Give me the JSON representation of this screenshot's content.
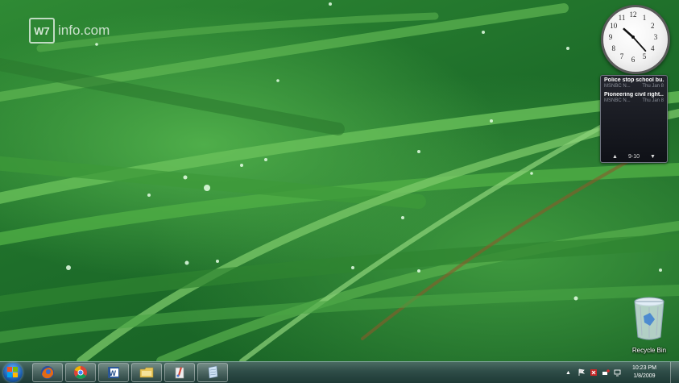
{
  "watermark": {
    "logo": "W7",
    "text": "info.com"
  },
  "clock_gadget": {
    "numerals": [
      "12",
      "1",
      "2",
      "3",
      "4",
      "5",
      "6",
      "7",
      "8",
      "9",
      "10",
      "11"
    ],
    "time_hour": 10,
    "time_minute": 23
  },
  "news_gadget": {
    "items": [
      {
        "headline": "Police stop school bu...",
        "source": "MSNBC N...",
        "date": "Thu Jan 8"
      },
      {
        "headline": "Pioneering civil right...",
        "source": "MSNBC N...",
        "date": "Thu Jan 8"
      }
    ],
    "pager": {
      "prev": "▲",
      "range": "9-10",
      "next": "▼"
    }
  },
  "desktop_icons": [
    {
      "label": "Recycle Bin",
      "icon": "recycle-bin-icon"
    }
  ],
  "taskbar": {
    "pinned": [
      {
        "name": "firefox",
        "icon": "firefox-icon"
      },
      {
        "name": "chrome",
        "icon": "chrome-icon"
      },
      {
        "name": "word",
        "icon": "word-icon"
      },
      {
        "name": "explorer",
        "icon": "folder-icon"
      },
      {
        "name": "paint",
        "icon": "paint-icon"
      },
      {
        "name": "notepad",
        "icon": "document-icon"
      }
    ],
    "tray": {
      "show_hidden": "▲",
      "time": "10:23 PM",
      "date": "1/8/2009"
    }
  },
  "colors": {
    "wallpaper_green": "#2f8a34",
    "taskbar": "#2e4c47",
    "gadget_dark": "#15171e"
  }
}
